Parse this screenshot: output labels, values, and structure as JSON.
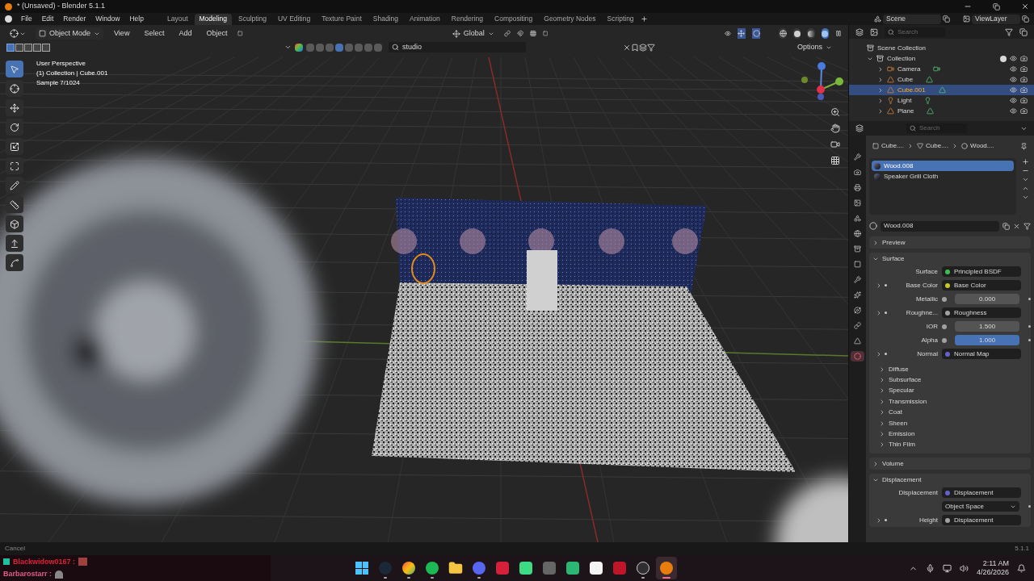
{
  "title_bar": {
    "title": "* (Unsaved) - Blender 5.1.1"
  },
  "menu": [
    "File",
    "Edit",
    "Render",
    "Window",
    "Help"
  ],
  "workspaces": [
    {
      "label": "Layout",
      "selected": false
    },
    {
      "label": "Modeling",
      "selected": true
    },
    {
      "label": "Sculpting",
      "selected": false
    },
    {
      "label": "UV Editing",
      "selected": false
    },
    {
      "label": "Texture Paint",
      "selected": false
    },
    {
      "label": "Shading",
      "selected": false
    },
    {
      "label": "Animation",
      "selected": false
    },
    {
      "label": "Rendering",
      "selected": false
    },
    {
      "label": "Compositing",
      "selected": false
    },
    {
      "label": "Geometry Nodes",
      "selected": false
    },
    {
      "label": "Scripting",
      "selected": false
    }
  ],
  "scene": {
    "scene": "Scene",
    "view_layer": "ViewLayer"
  },
  "viewport": {
    "mode": "Object Mode",
    "menus": [
      "View",
      "Select",
      "Add",
      "Object"
    ],
    "orientation": "Global",
    "search": "studio",
    "options": "Options",
    "select_modes": [
      {
        "selected": true
      },
      {
        "selected": false
      },
      {
        "selected": false
      },
      {
        "selected": false
      },
      {
        "selected": false
      }
    ],
    "filters": [
      {
        "selected": false
      },
      {
        "selected": false
      },
      {
        "selected": false
      },
      {
        "selected": true
      },
      {
        "selected": false
      },
      {
        "selected": false
      },
      {
        "selected": false
      },
      {
        "selected": false
      }
    ],
    "shading": [
      {
        "kind": "wireframe",
        "selected": false
      },
      {
        "kind": "solid",
        "selected": false
      },
      {
        "kind": "material",
        "selected": false
      },
      {
        "kind": "rendered",
        "selected": true
      }
    ],
    "overlay": [
      "User Perspective",
      "(1) Collection | Cube.001",
      "Sample 7/1024"
    ],
    "tools": [
      {
        "kind": "select",
        "selected": true
      },
      {
        "kind": "cursor",
        "selected": false
      },
      {
        "kind": "move",
        "selected": false
      },
      {
        "kind": "rotate",
        "selected": false
      },
      {
        "kind": "scale",
        "selected": false
      },
      {
        "kind": "transform",
        "selected": false
      },
      {
        "kind": "annotate",
        "selected": false
      },
      {
        "kind": "measure",
        "selected": false
      },
      {
        "kind": "add",
        "selected": false
      },
      {
        "kind": "extrude",
        "selected": false
      },
      {
        "kind": "curve",
        "selected": false
      }
    ]
  },
  "outliner": {
    "search": "Search",
    "root": "Scene Collection",
    "collection": {
      "label": "Collection",
      "expanded": true,
      "checked": true,
      "children": [
        {
          "label": "Camera",
          "kind": "camera",
          "selected": false
        },
        {
          "label": "Cube",
          "kind": "mesh",
          "selected": false
        },
        {
          "label": "Cube.001",
          "kind": "mesh",
          "selected": true
        },
        {
          "label": "Light",
          "kind": "light",
          "selected": false
        },
        {
          "label": "Plane",
          "kind": "mesh",
          "selected": false
        }
      ]
    }
  },
  "properties": {
    "search": "Search",
    "tabs": [
      {
        "kind": "tool",
        "selected": false
      },
      {
        "kind": "render",
        "selected": false
      },
      {
        "kind": "output",
        "selected": false
      },
      {
        "kind": "view_layer",
        "selected": false
      },
      {
        "kind": "scene",
        "selected": false
      },
      {
        "kind": "world",
        "selected": false
      },
      {
        "kind": "collection",
        "selected": false
      },
      {
        "kind": "object",
        "selected": false
      },
      {
        "kind": "modifier",
        "selected": false
      },
      {
        "kind": "particles",
        "selected": false
      },
      {
        "kind": "physics",
        "selected": false
      },
      {
        "kind": "constraints",
        "selected": false
      },
      {
        "kind": "data",
        "selected": false
      },
      {
        "kind": "material",
        "selected": true
      }
    ],
    "breadcrumb": [
      "Cube....",
      "Cube....",
      "Wood...."
    ],
    "slots": [
      {
        "label": "Wood.008",
        "selected": true
      },
      {
        "label": "Speaker Grill Cloth",
        "selected": false
      }
    ],
    "material": "Wood.008",
    "panels": [
      {
        "title": "Preview",
        "expanded": false
      },
      {
        "title": "Surface",
        "expanded": true,
        "rows": [
          {
            "kind": "link",
            "label": "Surface",
            "value": "Principled BSDF",
            "color": "#3fbf4f",
            "expandable": false
          },
          {
            "kind": "link",
            "label": "Base Color",
            "value": "Base Color",
            "color": "#c7c729",
            "expandable": true
          },
          {
            "kind": "slider",
            "label": "Metallic",
            "value": "0.000",
            "level": 0,
            "color": "#a1a1a1"
          },
          {
            "kind": "link",
            "label": "Roughne...",
            "value": "Roughness",
            "color": "#a1a1a1",
            "expandable": true
          },
          {
            "kind": "number",
            "label": "IOR",
            "value": "1.500",
            "color": "#a1a1a1"
          },
          {
            "kind": "slider",
            "label": "Alpha",
            "value": "1.000",
            "level": 1,
            "color": "#a1a1a1"
          },
          {
            "kind": "link",
            "label": "Normal",
            "value": "Normal Map",
            "color": "#6363c7",
            "expandable": true
          }
        ],
        "subpanels": [
          {
            "title": "Diffuse",
            "expanded": false
          },
          {
            "title": "Subsurface",
            "expanded": false
          },
          {
            "title": "Specular",
            "expanded": false
          },
          {
            "title": "Transmission",
            "expanded": false
          },
          {
            "title": "Coat",
            "expanded": false
          },
          {
            "title": "Sheen",
            "expanded": false
          },
          {
            "title": "Emission",
            "expanded": false
          },
          {
            "title": "Thin Film",
            "expanded": false
          }
        ]
      },
      {
        "title": "Volume",
        "expanded": false
      },
      {
        "title": "Displacement",
        "expanded": true,
        "rows": [
          {
            "kind": "link",
            "label": "Displacement",
            "value": "Displacement",
            "color": "#6363c7",
            "expandable": false
          },
          {
            "kind": "select",
            "value": "Object Space"
          },
          {
            "kind": "link",
            "label": "Height",
            "value": "Displacement",
            "color": "#a1a1a1",
            "expandable": true
          }
        ]
      }
    ]
  },
  "status_bar": {
    "hint": "Cancel",
    "version": "5.1.1"
  },
  "taskbar": {
    "chat": [
      {
        "user": "Blackwidow0167 :",
        "color": "#e0203a"
      },
      {
        "user": "Barbarostarr :",
        "color": "#e05a8a"
      }
    ],
    "apps": [
      {
        "kind": "start",
        "selected": false,
        "running": false
      },
      {
        "kind": "steam",
        "selected": false,
        "running": true
      },
      {
        "kind": "chrome",
        "selected": false,
        "running": true
      },
      {
        "kind": "spotify",
        "selected": false,
        "running": true
      },
      {
        "kind": "folder",
        "selected": false,
        "running": false
      },
      {
        "kind": "discord",
        "selected": false,
        "running": true
      },
      {
        "kind": "red",
        "selected": false,
        "running": false
      },
      {
        "kind": "android",
        "selected": false,
        "running": false
      },
      {
        "kind": "controller",
        "selected": false,
        "running": false
      },
      {
        "kind": "green",
        "selected": false,
        "running": false
      },
      {
        "kind": "white",
        "selected": false,
        "running": false
      },
      {
        "kind": "redm",
        "selected": false,
        "running": false
      },
      {
        "kind": "obs",
        "selected": false,
        "running": true
      },
      {
        "kind": "blender",
        "selected": true,
        "running": true
      }
    ],
    "time": "2:11 AM",
    "date": "4/26/2026"
  }
}
